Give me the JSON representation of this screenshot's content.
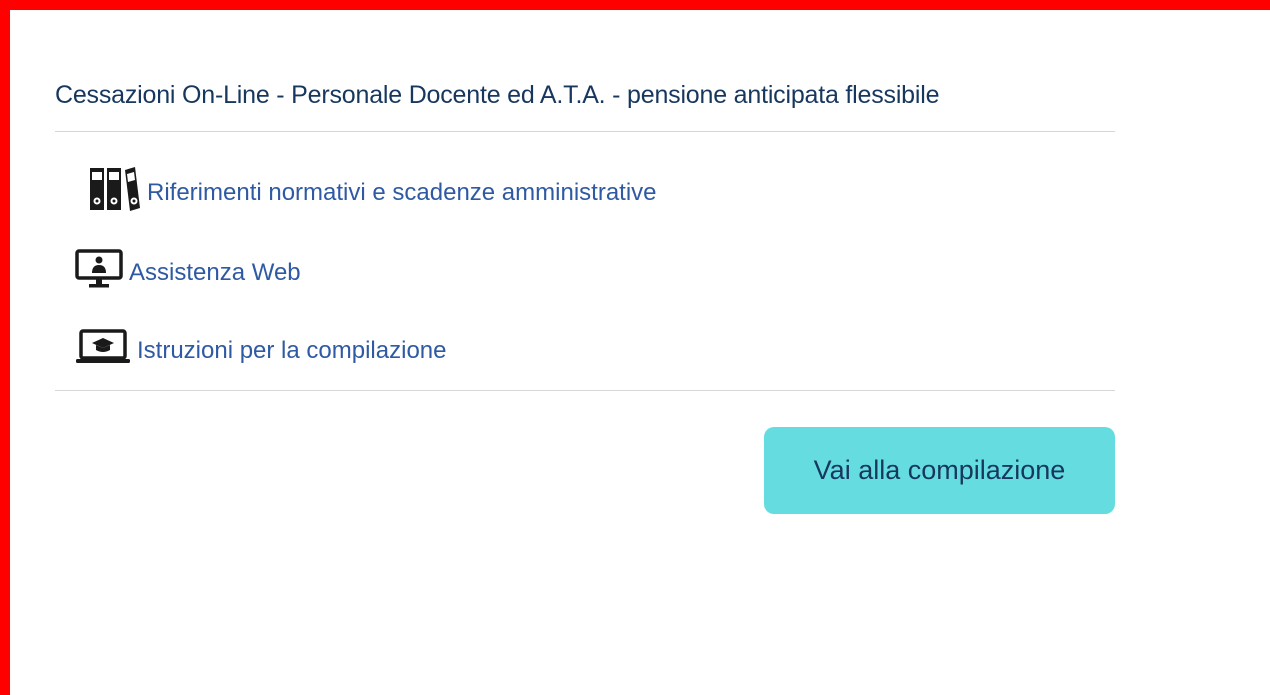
{
  "card": {
    "title": "Cessazioni On-Line - Personale Docente ed A.T.A. - pensione anticipata flessibile",
    "links": [
      {
        "label": "Riferimenti normativi e scadenze amministrative",
        "icon": "binders-icon"
      },
      {
        "label": "Assistenza Web",
        "icon": "monitor-person-icon"
      },
      {
        "label": "Istruzioni per la compilazione",
        "icon": "laptop-graduation-icon"
      }
    ],
    "primary_button_label": "Vai alla compilazione"
  },
  "colors": {
    "frame_border": "#ff0000",
    "title": "#17375e",
    "link": "#2f5aa3",
    "button_bg": "#65dde0",
    "divider": "#d6d6d6"
  }
}
